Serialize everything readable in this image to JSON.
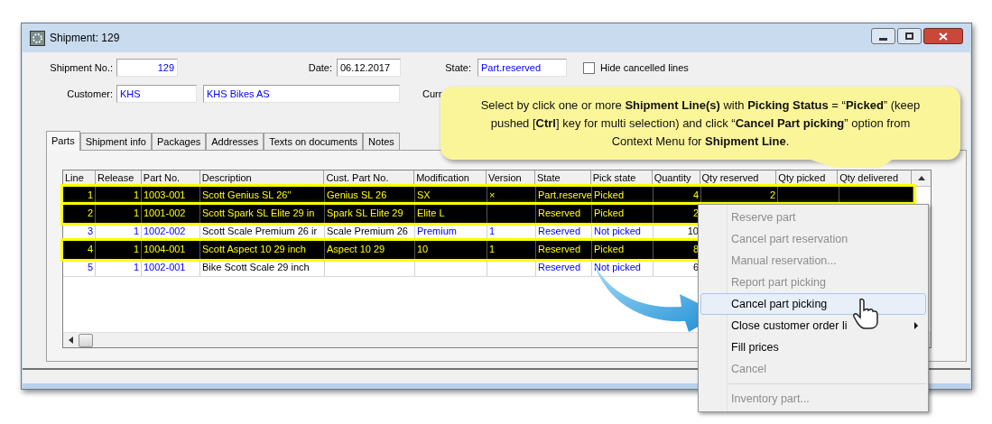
{
  "window": {
    "title": "Shipment: 129"
  },
  "form": {
    "shipment_no_label": "Shipment No.:",
    "shipment_no": "129",
    "date_label": "Date:",
    "date": "06.12.2017",
    "state_label": "State:",
    "state": "Part.reserved",
    "hide_cancelled": {
      "label": "Hide cancelled lines",
      "checked": false
    },
    "customer_label": "Customer:",
    "customer_code": "KHS",
    "customer_name": "KHS Bikes AS",
    "currency_label": "Curr"
  },
  "tabs": [
    {
      "label": "Parts",
      "selected": true
    },
    {
      "label": "Shipment info",
      "selected": false
    },
    {
      "label": "Packages",
      "selected": false
    },
    {
      "label": "Addresses",
      "selected": false
    },
    {
      "label": "Texts on documents",
      "selected": false
    },
    {
      "label": "Notes",
      "selected": false
    }
  ],
  "table": {
    "columns": [
      "Line",
      "Release",
      "Part No.",
      "Description",
      "Cust. Part No.",
      "Modification",
      "Version",
      "State",
      "Pick state",
      "Quantity",
      "Qty reserved",
      "Qty picked",
      "Qty delivered"
    ],
    "rows": [
      {
        "selected": true,
        "cells": [
          "1",
          "1",
          "1003-001",
          "Scott Genius SL 26''",
          "Genius SL 26",
          "SX",
          "×",
          "Part.reserve",
          "Picked",
          "4",
          "2"
        ]
      },
      {
        "selected": true,
        "cells": [
          "2",
          "1",
          "1001-002",
          "Scott Spark SL Elite 29 in",
          "Spark SL Elite 29",
          "Elite L",
          null,
          "Reserved",
          "Picked",
          "2"
        ]
      },
      {
        "selected": false,
        "cells": [
          "3",
          "1",
          "1002-002",
          "Scott Scale Premium 26 ir",
          "Scale Premium 26",
          "Premium",
          "1",
          "Reserved",
          "Not picked",
          "10"
        ]
      },
      {
        "selected": true,
        "cells": [
          "4",
          "1",
          "1004-001",
          "Scott Aspect 10 29 inch",
          "Aspect 10 29",
          "10",
          "1",
          "Reserved",
          "Picked",
          "8"
        ]
      },
      {
        "selected": false,
        "cells": [
          "5",
          "1",
          "1002-001",
          "Bike Scott Scale 29 inch",
          null,
          null,
          null,
          "Reserved",
          "Not picked",
          "6"
        ]
      }
    ]
  },
  "callout": {
    "text": "Select by click one or more **Shipment Line(s)** with **Picking Status** = “**Picked**” (keep pushed [**Ctrl**] key for multi selection) and click “**Cancel Part picking**” option from Context Menu for **Shipment Line**."
  },
  "context_menu": [
    {
      "label": "Reserve part",
      "disabled": true,
      "selected": false
    },
    {
      "label": "Cancel part reservation",
      "disabled": true,
      "selected": false
    },
    {
      "label": "Manual reservation...",
      "disabled": true,
      "selected": false
    },
    {
      "label": "Report part picking",
      "disabled": true,
      "selected": false
    },
    {
      "label": "Cancel part picking",
      "disabled": false,
      "selected": true
    },
    {
      "label": "Close customer order li",
      "disabled": false,
      "selected": false,
      "submenu": true
    },
    {
      "label": "Fill prices",
      "disabled": false,
      "selected": false
    },
    {
      "label": "Cancel",
      "disabled": true,
      "selected": false
    },
    {
      "label": "Inventory part...",
      "disabled": true,
      "selected": false,
      "separator_before": true
    }
  ]
}
